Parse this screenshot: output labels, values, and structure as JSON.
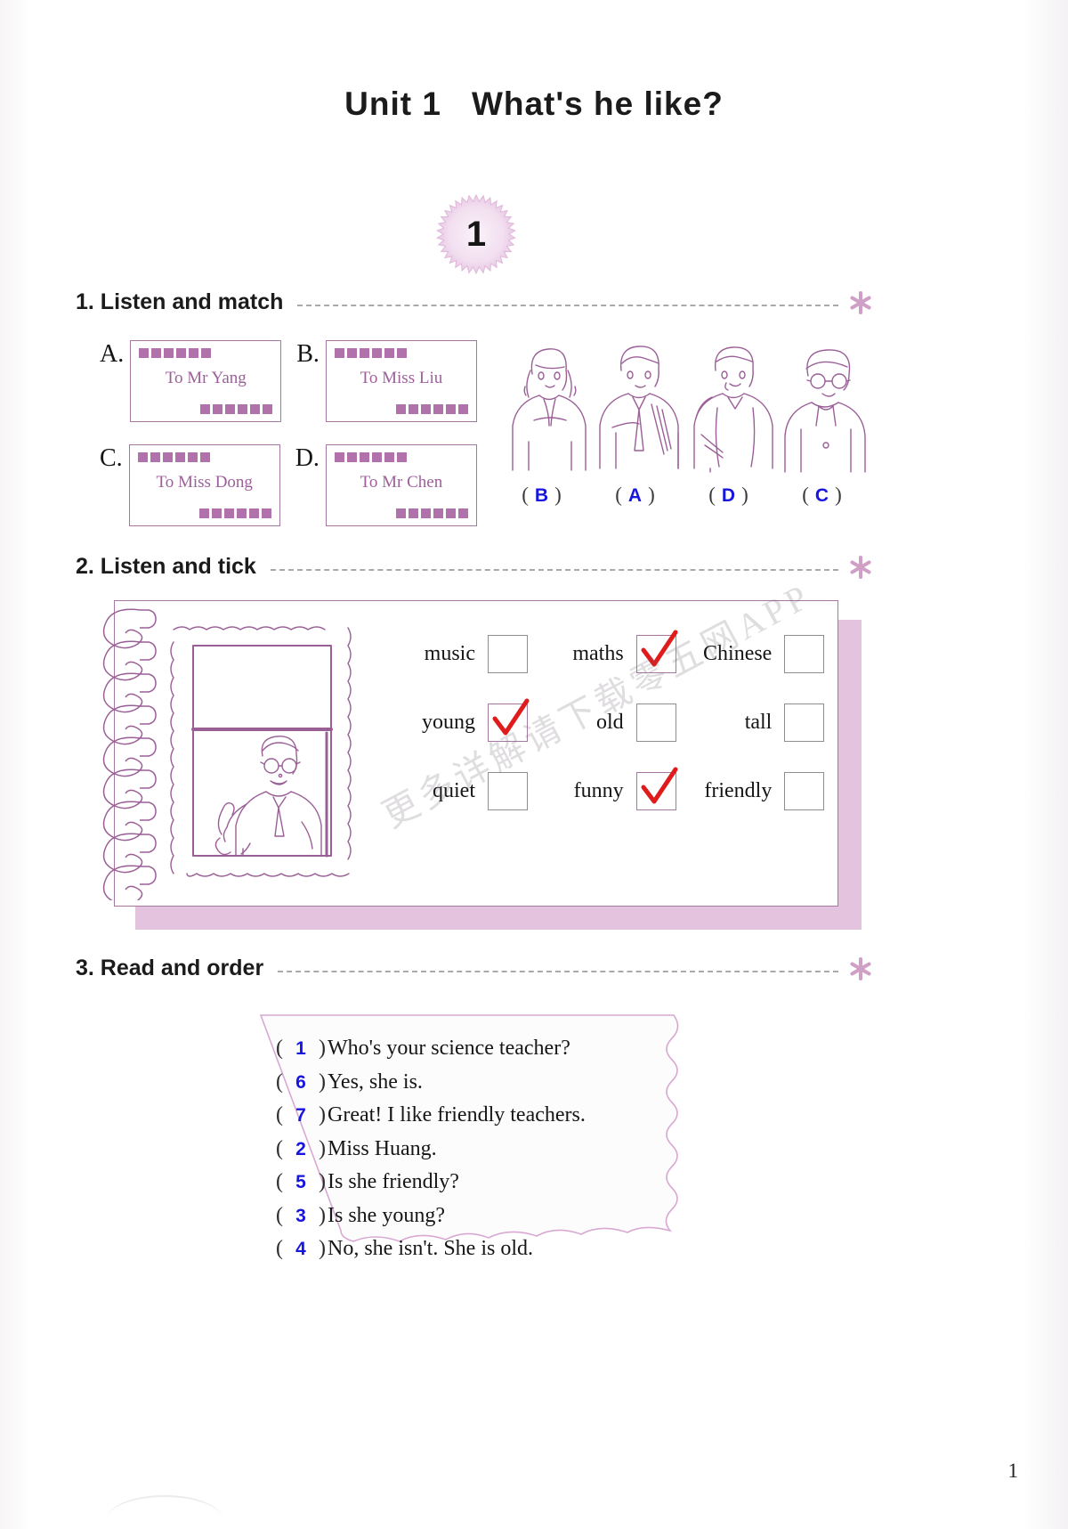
{
  "page": {
    "unit_title_prefix": "Unit 1",
    "unit_title_main": "What's he like?",
    "badge_number": "1",
    "page_number": "1",
    "watermark": "更多详解请下载零五网APP",
    "accent_color": "#a777a3",
    "answer_color": "#1616e0",
    "tick_color": "#e01b1b"
  },
  "exercise1": {
    "number": "1.",
    "heading": "1. Listen and match",
    "cards": [
      {
        "letter": "A.",
        "text": "To Mr Yang"
      },
      {
        "letter": "B.",
        "text": "To Miss Liu"
      },
      {
        "letter": "C.",
        "text": "To Miss Dong"
      },
      {
        "letter": "D.",
        "text": "To Mr Chen"
      }
    ],
    "answers": [
      {
        "open": "(",
        "value": "B",
        "close": ")"
      },
      {
        "open": "(",
        "value": "A",
        "close": ")"
      },
      {
        "open": "(",
        "value": "D",
        "close": ")"
      },
      {
        "open": "(",
        "value": "C",
        "close": ")"
      }
    ]
  },
  "exercise2": {
    "heading": "2. Listen and tick",
    "options": [
      {
        "label": "music",
        "checked": false
      },
      {
        "label": "maths",
        "checked": true
      },
      {
        "label": "Chinese",
        "checked": false
      },
      {
        "label": "young",
        "checked": true
      },
      {
        "label": "old",
        "checked": false
      },
      {
        "label": "tall",
        "checked": false
      },
      {
        "label": "quiet",
        "checked": false
      },
      {
        "label": "funny",
        "checked": true
      },
      {
        "label": "friendly",
        "checked": false
      }
    ]
  },
  "exercise3": {
    "heading": "3. Read and order",
    "items": [
      {
        "open": "(",
        "num": "1",
        "close": ")",
        "text": "Who's your science teacher?"
      },
      {
        "open": "(",
        "num": "6",
        "close": ")",
        "text": "Yes, she is."
      },
      {
        "open": "(",
        "num": "7",
        "close": ")",
        "text": "Great! I like friendly teachers."
      },
      {
        "open": "(",
        "num": "2",
        "close": ")",
        "text": "Miss Huang."
      },
      {
        "open": "(",
        "num": "5",
        "close": ")",
        "text": "Is she friendly?"
      },
      {
        "open": "(",
        "num": "3",
        "close": ")",
        "text": "Is she young?"
      },
      {
        "open": "(",
        "num": "4",
        "close": ")",
        "text": "No, she isn't. She is old."
      }
    ]
  }
}
